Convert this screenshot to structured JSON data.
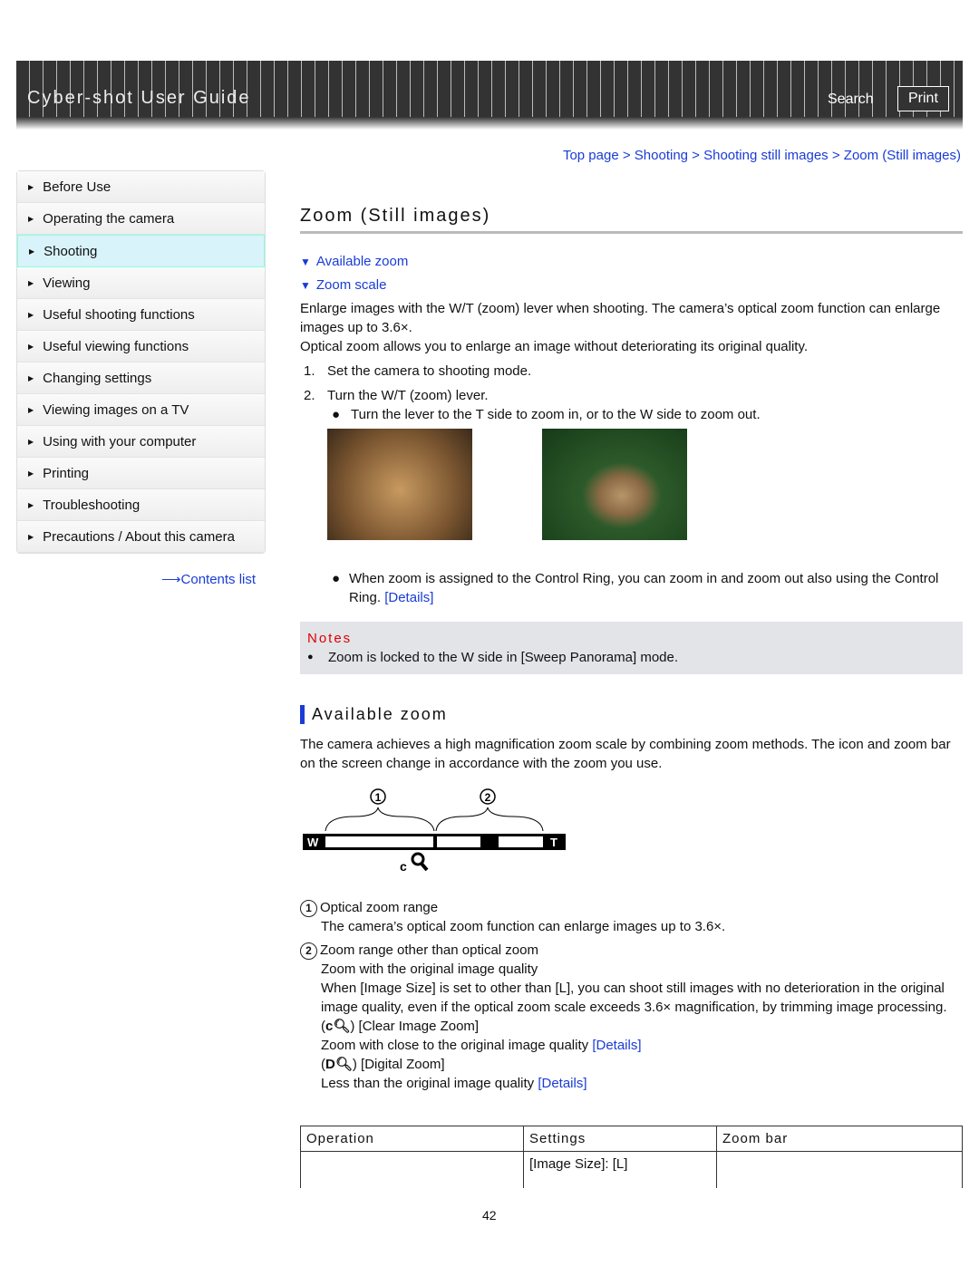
{
  "header": {
    "title": "Cyber-shot User Guide",
    "search": "Search",
    "print": "Print"
  },
  "breadcrumb": [
    "Top page",
    "Shooting",
    "Shooting still images",
    "Zoom (Still images)"
  ],
  "sidebar": {
    "items": [
      "Before Use",
      "Operating the camera",
      "Shooting",
      "Viewing",
      "Useful shooting functions",
      "Useful viewing functions",
      "Changing settings",
      "Viewing images on a TV",
      "Using with your computer",
      "Printing",
      "Troubleshooting",
      "Precautions / About this camera"
    ],
    "active": "Shooting",
    "contents_list": "Contents list"
  },
  "main": {
    "title": "Zoom (Still images)",
    "anchors": [
      "Available zoom",
      "Zoom scale"
    ],
    "intro1": "Enlarge images with the W/T (zoom) lever when shooting. The camera’s optical zoom function can enlarge images up to 3.6×.",
    "intro2": "Optical zoom allows you to enlarge an image without deteriorating its original quality.",
    "steps": [
      {
        "n": "1.",
        "t": "Set the camera to shooting mode."
      },
      {
        "n": "2.",
        "t": "Turn the W/T (zoom) lever."
      }
    ],
    "bullet1": "Turn the lever to the T side to zoom in, or to the W side to zoom out.",
    "bullet2": "When zoom is assigned to the Control Ring, you can zoom in and zoom out also using the Control Ring.",
    "details": "[Details]",
    "notes_title": "Notes",
    "note1": "Zoom is locked to the W side in [Sweep Panorama] mode.",
    "section": "Available zoom",
    "section_text": "The camera achieves a high magnification zoom scale by combining zoom methods. The icon and zoom bar on the screen change in accordance with the zoom you use.",
    "diagram": {
      "w": "W",
      "t": "T",
      "c": "c",
      "n1": "1",
      "n2": "2"
    },
    "item1_title": "Optical zoom range",
    "item1_text": "The camera’s optical zoom function can enlarge images up to 3.6×.",
    "item2_title": "Zoom range other than optical zoom",
    "item2_a": "Zoom with the original image quality",
    "item2_b": "When [Image Size] is set to other than [L], you can shoot still images with no deterioration in the original image quality, even if the optical zoom scale exceeds 3.6× magnification, by trimming image processing.",
    "clear_label": ") [Clear Image Zoom]",
    "clear_text": "Zoom with close to the original image quality",
    "digital_label": ") [Digital Zoom]",
    "digital_text": "Less than the original image quality",
    "table": {
      "headers": [
        "Operation",
        "Settings",
        "Zoom bar"
      ],
      "row1": [
        "",
        "[Image Size]: [L]",
        ""
      ]
    }
  },
  "page_number": "42"
}
